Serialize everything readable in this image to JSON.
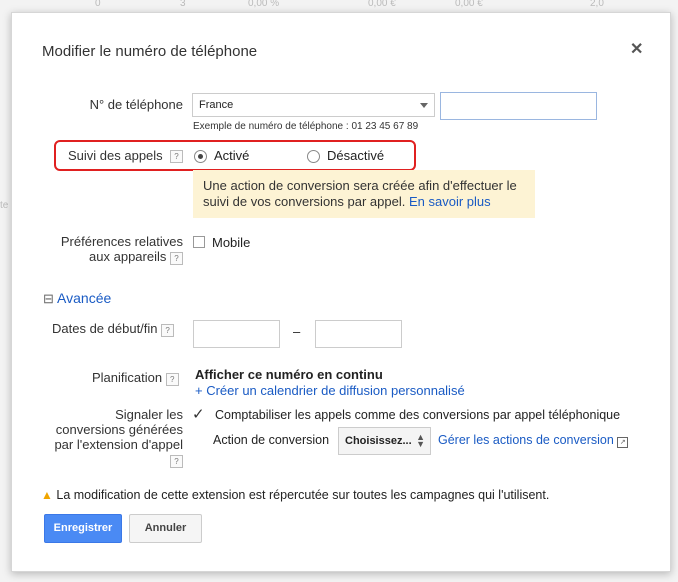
{
  "background": {
    "row_values": [
      "0",
      "3",
      "0,00 %",
      "0,00 €",
      "0,00 €",
      "2,0"
    ],
    "left_text": "te"
  },
  "dialog": {
    "title": "Modifier le numéro de téléphone",
    "close_icon": "close-icon"
  },
  "phone": {
    "label": "N° de téléphone",
    "country": "France",
    "number_value": "",
    "example": "Exemple de numéro de téléphone : 01 23 45 67 89"
  },
  "call_tracking": {
    "label": "Suivi des appels",
    "help": "?",
    "option_on": "Activé",
    "option_off": "Désactivé",
    "selected": "Activé",
    "highlight_color": "#e02020",
    "notice_text": "Une action de conversion sera créée afin d'effectuer le suivi de vos conversions par appel.",
    "notice_link": "En savoir plus"
  },
  "device": {
    "label_line1": "Préférences relatives",
    "label_line2": "aux appareils",
    "checkbox_label": "Mobile",
    "checked": false
  },
  "advanced": {
    "toggle": "⊟",
    "label": "Avancée"
  },
  "dates": {
    "label": "Dates de début/fin",
    "separator": "–",
    "start": "",
    "end": ""
  },
  "schedule": {
    "label": "Planification",
    "value": "Afficher ce numéro en continu",
    "link": "+ Créer un calendrier de diffusion personnalisé"
  },
  "report": {
    "label_line1": "Signaler les",
    "label_line2": "conversions générées",
    "label_line3": "par l'extension d'appel",
    "checkbox_label": "Comptabiliser les appels comme des conversions par appel téléphonique",
    "checked": true,
    "action_label": "Action de conversion",
    "action_select": "Choisissez...",
    "manage_link": "Gérer les actions de conversion"
  },
  "warning": {
    "text": "La modification de cette extension est répercutée sur toutes les campagnes qui l'utilisent."
  },
  "buttons": {
    "save": "Enregistrer",
    "cancel": "Annuler"
  },
  "colors": {
    "primary": "#4a8af4",
    "link": "#1a5bc4",
    "notice_bg": "#fdf3d4",
    "warning": "#f0a500"
  }
}
